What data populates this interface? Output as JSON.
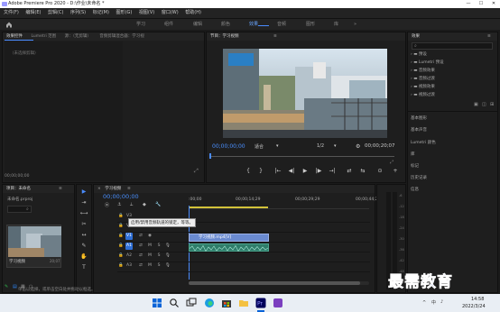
{
  "window": {
    "title": "Adobe Premiere Pro 2020 - D:\\作业\\未命名 *",
    "min_glyph": "—",
    "max_glyph": "☐",
    "close_glyph": "✕"
  },
  "menu": [
    "文件(F)",
    "编辑(E)",
    "剪辑(C)",
    "序列(S)",
    "标记(M)",
    "图形(G)",
    "视图(V)",
    "窗口(W)",
    "帮助(H)"
  ],
  "workspaces": {
    "items": [
      "学习",
      "组件",
      "编辑",
      "颜色",
      "效果",
      "音频",
      "图形",
      "库"
    ],
    "active_index": 4,
    "overflow": "»"
  },
  "source_panel": {
    "tabs": [
      "效果控件",
      "Lumetri 范围",
      "源：（无剪辑）",
      "音频剪辑混合器：学习视"
    ],
    "menu_glyph": "≡",
    "empty_text": "（未选择剪辑）",
    "timecode": "00;00;00;00"
  },
  "program_monitor": {
    "title": "节目：学习视频",
    "menu_glyph": "≡",
    "current_time": "00;00;00;00",
    "fit": "适合",
    "resolution": "1/2",
    "duration": "00;00;20;07",
    "controls": [
      "{",
      "}",
      "|←",
      "◀|",
      "▶",
      "|▶",
      "→|",
      "⇄",
      "⇆",
      "⊙"
    ],
    "add_glyph": "+",
    "settings_glyph": "⚙",
    "export_glyph": "⤢"
  },
  "effects_panel": {
    "title": "效果",
    "menu_glyph": "≡",
    "search_icon": "⌕",
    "items": [
      "预设",
      "Lumetri 预设",
      "音频效果",
      "音频过渡",
      "视频效果",
      "视频过渡"
    ],
    "toolbar_glyphs": [
      "▣",
      "◫",
      "⊞"
    ],
    "sections": [
      "基本图形",
      "基本声音",
      "Lumetri 颜色",
      "库",
      "标记",
      "历史记录",
      "信息"
    ]
  },
  "project_panel": {
    "title": "项目：未命名",
    "menu_glyph": "≡",
    "file": "未命名.prproj",
    "search_icon": "⌕",
    "clip_label": "学习视频",
    "clip_duration": "20;07",
    "status": "单击以选择，或单击空白处并拖动以框选。",
    "footer_glyphs": [
      "✎",
      "▤",
      "▦",
      "○"
    ]
  },
  "timeline": {
    "title": "学习视频",
    "close_glyph": "×",
    "menu_glyph": "≡",
    "timecode": "00;00;00;00",
    "ruler": [
      ":00;00",
      "00;00;14;29",
      "00;00;29;29",
      "00;00;44;28"
    ],
    "tooltip": "启用/禁用音频轨道的锁定，等等。",
    "tracks": [
      {
        "id": "V3",
        "type": "video"
      },
      {
        "id": "V2",
        "type": "video"
      },
      {
        "id": "V1",
        "type": "video",
        "target": true
      },
      {
        "id": "A1",
        "type": "audio",
        "target": true
      },
      {
        "id": "A2",
        "type": "audio"
      },
      {
        "id": "A3",
        "type": "audio"
      }
    ],
    "video_clip": "学习视频.mp4[V]",
    "tool_glyphs": [
      "⦿",
      "⚓",
      "⟂",
      "◆",
      "🔧"
    ],
    "track_lock_glyph": "🔒",
    "track_buttons": [
      "⇄",
      "M",
      "S",
      "🎙"
    ],
    "audio_meter_scale": [
      "-6",
      "-12",
      "-18",
      "-24",
      "-30",
      "-36",
      "-42",
      "-48",
      "-54"
    ]
  },
  "tools": [
    "▶",
    "⇥",
    "⟷",
    "✂",
    "↔",
    "✎",
    "✋",
    "T"
  ],
  "taskbar": {
    "icons": [
      "windows-start",
      "search",
      "task-view",
      "edge",
      "store",
      "explorer",
      "premiere",
      "other"
    ],
    "time": "14:58",
    "date": "2022/3/24",
    "tray": [
      "^",
      "中",
      "♪"
    ]
  },
  "watermark": "最需教育"
}
